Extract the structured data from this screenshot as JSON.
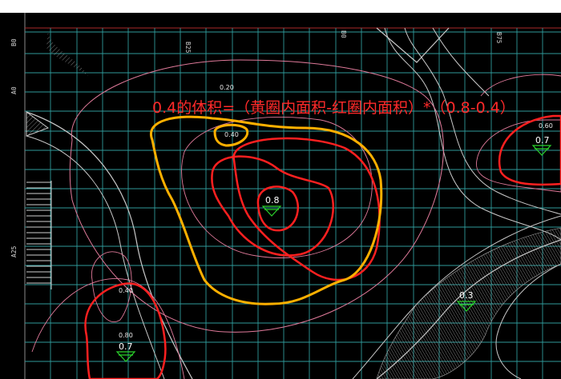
{
  "annotation": "0.4的体积=（黄圈内面积-红圈内面积）*（0.8-0.4）",
  "grid_labels": {
    "left_b0": "B0",
    "left_a0": "A0",
    "left_a25": "A25",
    "top_b25": "B25",
    "top_b0": "B0",
    "top_b75": "B75"
  },
  "elevations": {
    "contour_020": "0.20",
    "contour_040_top": "0.40",
    "contour_060_right": "0.60",
    "contour_040_left": "0.40",
    "contour_080_left": "0.80"
  },
  "markers": {
    "center": "0.8",
    "right": "0.7",
    "lower_right": "0.3",
    "lower_left": "0.7"
  },
  "colors": {
    "background": "#000000",
    "grid": "#2f9a9a",
    "contour": "#e07a9a",
    "red_outline": "#ff2020",
    "yellow_outline": "#ffb000",
    "paths": "#bdbdbd",
    "marker": "#2bd12b",
    "annotation": "#ff2a2a"
  }
}
